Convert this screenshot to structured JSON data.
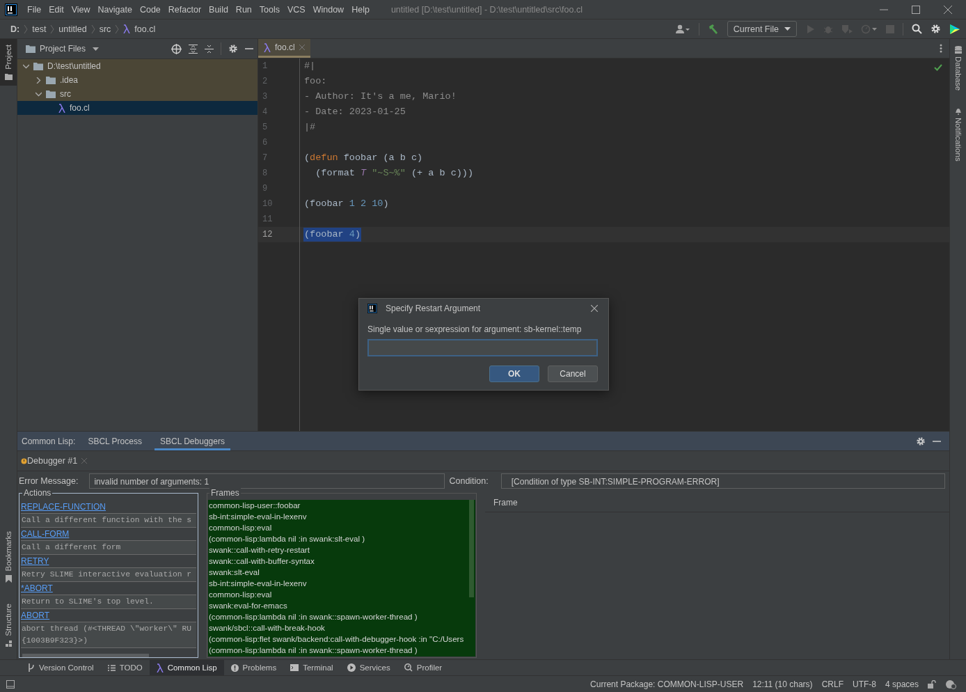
{
  "menu": [
    {
      "label": "File"
    },
    {
      "label": "Edit"
    },
    {
      "label": "View"
    },
    {
      "label": "Navigate"
    },
    {
      "label": "Code"
    },
    {
      "label": "Refactor"
    },
    {
      "label": "Build"
    },
    {
      "label": "Run"
    },
    {
      "label": "Tools"
    },
    {
      "label": "VCS"
    },
    {
      "label": "Window"
    },
    {
      "label": "Help"
    }
  ],
  "window_title": "untitled [D:\\test\\untitled] - D:\\test\\untitled\\src\\foo.cl",
  "breadcrumbs": [
    "D:",
    "test",
    "untitled",
    "src",
    "foo.cl"
  ],
  "run_config": "Current File",
  "left_stripe": {
    "top": [
      {
        "label": "Project",
        "selected": true
      }
    ],
    "bottom": [
      {
        "label": "Bookmarks",
        "selected": false
      },
      {
        "label": "Structure",
        "selected": false
      }
    ]
  },
  "right_stripe": [
    {
      "label": "Database"
    },
    {
      "label": "Notifications"
    }
  ],
  "project_panel": {
    "title": "Project Files",
    "tree": [
      {
        "label": "D:\\test\\untitled",
        "kind": "folder",
        "expanded": true,
        "selected": false,
        "children": [
          {
            "label": ".idea",
            "kind": "folder",
            "expanded": false,
            "selected": false
          },
          {
            "label": "src",
            "kind": "folder",
            "expanded": true,
            "selected": false,
            "children": [
              {
                "label": "foo.cl",
                "kind": "file",
                "selected": true
              }
            ]
          }
        ]
      }
    ]
  },
  "editor": {
    "tabs": [
      {
        "label": "foo.cl",
        "selected": true
      }
    ],
    "lines": [
      {
        "number": "1",
        "selected": false,
        "tokens": [
          {
            "kind": "comment",
            "text": "#|"
          }
        ]
      },
      {
        "number": "2",
        "selected": false,
        "tokens": [
          {
            "kind": "comment",
            "text": "foo:"
          }
        ]
      },
      {
        "number": "3",
        "selected": false,
        "tokens": [
          {
            "kind": "comment",
            "text": "- Author: It's a me, Mario!"
          }
        ]
      },
      {
        "number": "4",
        "selected": false,
        "tokens": [
          {
            "kind": "comment",
            "text": "- Date: 2023-01-25"
          }
        ]
      },
      {
        "number": "5",
        "selected": false,
        "tokens": [
          {
            "kind": "comment",
            "text": "|#"
          }
        ]
      },
      {
        "number": "6",
        "selected": false
      },
      {
        "number": "7",
        "selected": false,
        "tokens": [
          {
            "kind": "plain",
            "text": "("
          },
          {
            "kind": "keyword",
            "text": "defun"
          },
          {
            "kind": "plain",
            "text": " foobar (a b c)"
          }
        ]
      },
      {
        "number": "8",
        "selected": false,
        "tokens": [
          {
            "kind": "plain",
            "text": "  (format "
          },
          {
            "kind": "constant",
            "text": "T "
          },
          {
            "kind": "string",
            "text": "\"~S~%\""
          },
          {
            "kind": "plain",
            "text": " (+ a b c)))"
          }
        ]
      },
      {
        "number": "9",
        "selected": false
      },
      {
        "number": "10",
        "selected": false,
        "tokens": [
          {
            "kind": "plain",
            "text": "(foobar "
          },
          {
            "kind": "number",
            "text": "1 2 10"
          },
          {
            "kind": "plain",
            "text": ")"
          }
        ]
      },
      {
        "number": "11",
        "selected": false
      },
      {
        "number": "12",
        "selected": true,
        "tokens": [
          {
            "kind": "plain",
            "text": "(foobar "
          },
          {
            "kind": "number",
            "text": "4"
          },
          {
            "kind": "plain",
            "text": ")"
          }
        ]
      }
    ]
  },
  "dialog": {
    "title": "Specify Restart Argument",
    "label": "Single value or sexpression for argument: sb-kernel::temp",
    "buttons": [
      {
        "label": "OK",
        "kind": "primary"
      },
      {
        "label": "Cancel",
        "kind": "secondary"
      }
    ]
  },
  "tool_window": {
    "prefix": "Common Lisp:",
    "tabs": [
      {
        "label": "SBCL Process",
        "selected": false
      },
      {
        "label": "SBCL Debuggers",
        "selected": true
      }
    ],
    "debugger_tab": "Debugger #1",
    "error_label": "Error Message:",
    "error_value": "invalid number of arguments: 1",
    "condition_label": "Condition:",
    "condition_value": "[Condition of type SB-INT:SIMPLE-PROGRAM-ERROR]",
    "actions_title": "Actions",
    "actions": [
      {
        "name": "REPLACE-FUNCTION",
        "description": "Call a different function with the s"
      },
      {
        "name": "CALL-FORM",
        "description": "Call a different form"
      },
      {
        "name": "RETRY",
        "description": "Retry SLIME interactive evaluation r"
      },
      {
        "name": "*ABORT",
        "description": "Return to SLIME's top level."
      },
      {
        "name": "ABORT",
        "description": "abort thread (#<THREAD \\\"worker\\\" RU\n{1003B9F323}>)"
      }
    ],
    "frames_title": "Frames",
    "frames": [
      "common-lisp-user::foobar",
      "sb-int:simple-eval-in-lexenv",
      "common-lisp:eval",
      "(common-lisp:lambda nil :in swank:slt-eval )",
      "swank::call-with-retry-restart",
      "swank::call-with-buffer-syntax",
      "swank:slt-eval",
      "sb-int:simple-eval-in-lexenv",
      "common-lisp:eval",
      "swank:eval-for-emacs",
      "(common-lisp:lambda nil :in swank::spawn-worker-thread )",
      "swank/sbcl::call-with-break-hook",
      "(common-lisp:flet swank/backend:call-with-debugger-hook :in \"C:/Users",
      "(common-lisp:lambda nil :in swank::spawn-worker-thread )"
    ],
    "frame_header": "Frame"
  },
  "tool_bar": [
    {
      "label": "Version Control",
      "selected": false
    },
    {
      "label": "TODO",
      "selected": false
    },
    {
      "label": "Common Lisp",
      "selected": true
    },
    {
      "label": "Problems",
      "selected": false
    },
    {
      "label": "Terminal",
      "selected": false
    },
    {
      "label": "Services",
      "selected": false
    },
    {
      "label": "Profiler",
      "selected": false
    }
  ],
  "status": [
    "Current Package: COMMON-LISP-USER",
    "12:11 (10 chars)",
    "CRLF",
    "UTF-8",
    "4 spaces"
  ]
}
